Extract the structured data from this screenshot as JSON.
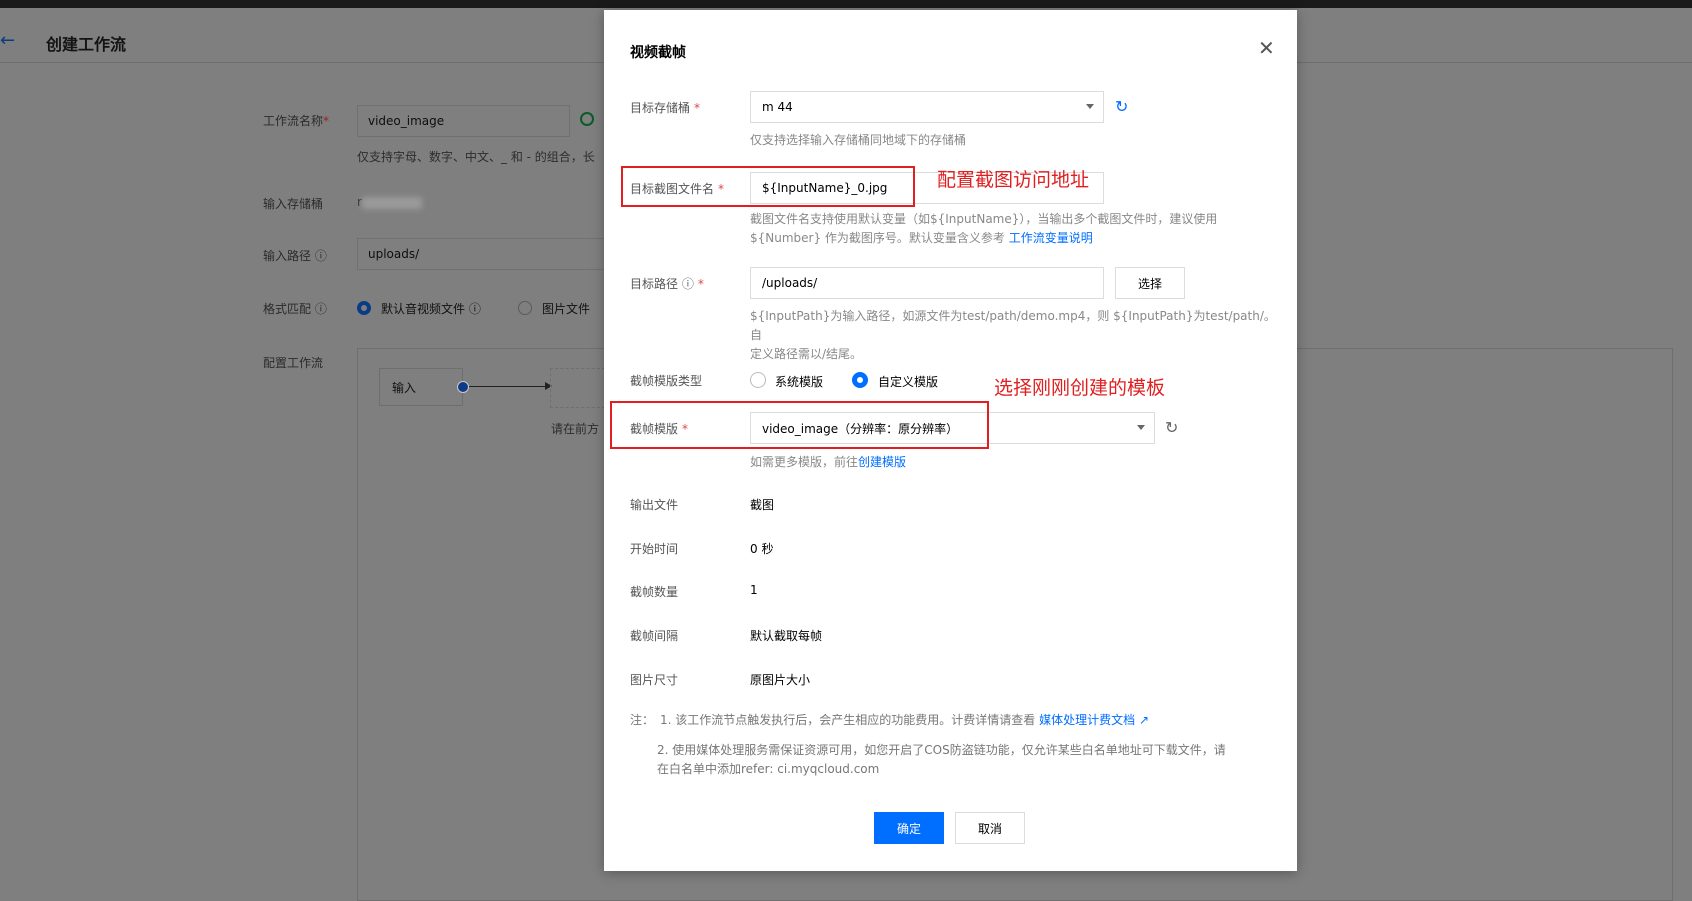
{
  "page": {
    "back_icon": "←",
    "title": "创建工作流"
  },
  "background_form": {
    "name_label": "工作流名称",
    "name_value": "video_image",
    "name_hint": "仅支持字母、数字、中文、_ 和 - 的组合，长",
    "input_bucket_label": "输入存储桶",
    "input_bucket_value": "r",
    "input_path_label": "输入路径",
    "input_path_value": "uploads/",
    "format_label": "格式匹配",
    "format_option_av": "默认音视频文件",
    "format_option_img": "图片文件",
    "config_label": "配置工作流",
    "node_input": "输入",
    "flow_hint": "请在前方"
  },
  "modal": {
    "title": "视频截帧",
    "target_bucket_label": "目标存储桶",
    "target_bucket_value": "m          44",
    "target_bucket_hint": "仅支持选择输入存储桶同地域下的存储桶",
    "filename_label": "目标截图文件名",
    "filename_value": "${InputName}_0.jpg",
    "filename_hint_1": "截图文件名支持使用默认变量（如${InputName}），当输出多个截图文件时，建议使用",
    "filename_hint_2": "${Number} 作为截图序号。默认变量含义参考",
    "filename_hint_link": "工作流变量说明",
    "target_path_label": "目标路径",
    "target_path_value": "/uploads/",
    "select_button": "选择",
    "target_path_hint_1": "${InputPath}为输入路径，如源文件为test/path/demo.mp4，则 ${InputPath}为test/path/。自",
    "target_path_hint_2": "定义路径需以/结尾。",
    "template_type_label": "截帧模版类型",
    "template_type_system": "系统模版",
    "template_type_custom": "自定义模版",
    "template_label": "截帧模版",
    "template_value": "video_image（分辨率：原分辨率）",
    "template_hint": "如需更多模版，前往",
    "template_hint_link": "创建模版",
    "output_file_label": "输出文件",
    "output_file_value": "截图",
    "start_time_label": "开始时间",
    "start_time_value": "0 秒",
    "frame_count_label": "截帧数量",
    "frame_count_value": "1",
    "frame_interval_label": "截帧间隔",
    "frame_interval_value": "默认截取每帧",
    "image_size_label": "图片尺寸",
    "image_size_value": "原图片大小",
    "note_prefix": "注：",
    "note_1": "1. 该工作流节点触发执行后，会产生相应的功能费用。计费详情请查看",
    "note_1_link": "媒体处理计费文档",
    "note_2a": "2. 使用媒体处理服务需保证资源可用，如您开启了COS防盗链功能，仅允许某些白名单地址可下载文件，请",
    "note_2b": "在白名单中添加refer: ci.myqcloud.com",
    "ok_button": "确定",
    "cancel_button": "取消"
  },
  "annotations": {
    "filename_note": "配置截图访问地址",
    "template_note": "选择刚刚创建的模板"
  },
  "colors": {
    "accent": "#006eff",
    "required": "#e54545",
    "annotation": "#e02020"
  }
}
